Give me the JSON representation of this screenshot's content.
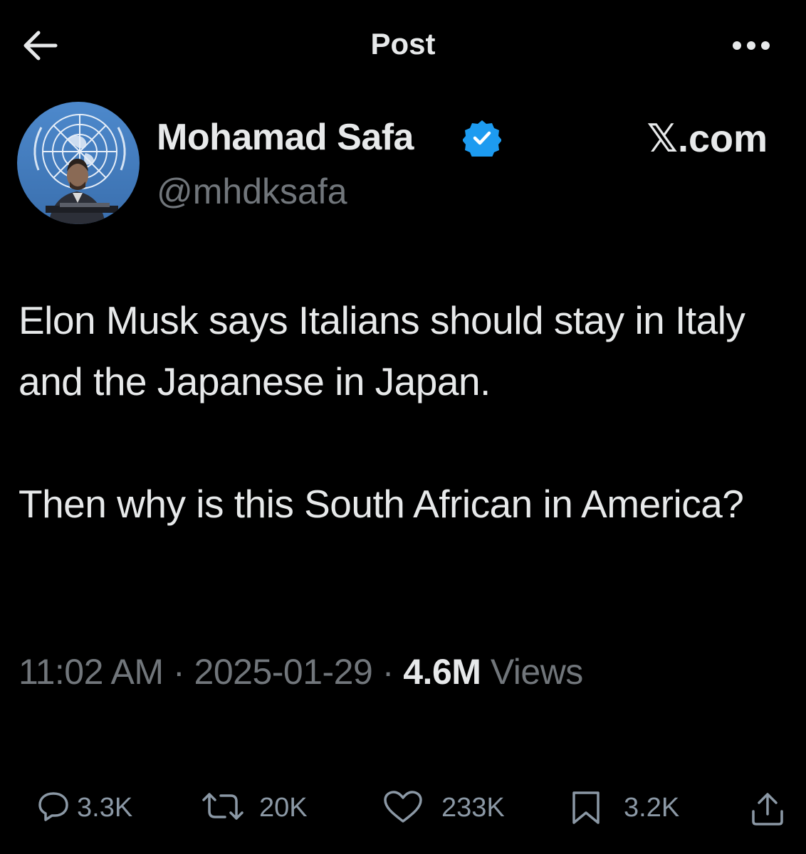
{
  "header": {
    "title": "Post",
    "back_icon": "arrow-left-icon",
    "more_icon": "more-horizontal-icon"
  },
  "author": {
    "name": "Mohamad Safa",
    "handle": "@mhdksafa",
    "verified": true,
    "verified_color": "#1d9bf0"
  },
  "site_tag": "𝕏.com",
  "post": {
    "paragraphs": [
      "Elon Musk says Italians should stay in Italy and the Japanese in Japan.",
      "Then why is this South African in America?"
    ]
  },
  "meta": {
    "time": "11:02 AM",
    "separator": "·",
    "date": "2025-01-29",
    "views_count": "4.6M",
    "views_label": "Views"
  },
  "actions": {
    "replies": {
      "icon": "reply-icon",
      "count": "3.3K"
    },
    "reposts": {
      "icon": "repost-icon",
      "count": "20K"
    },
    "likes": {
      "icon": "heart-icon",
      "count": "233K"
    },
    "bookmarks": {
      "icon": "bookmark-icon",
      "count": "3.2K"
    },
    "share": {
      "icon": "share-icon"
    }
  },
  "colors": {
    "background": "#000000",
    "text_primary": "#e7e9ea",
    "text_secondary": "#71767b",
    "action_gray": "#8b98a5",
    "accent_blue": "#1d9bf0"
  }
}
